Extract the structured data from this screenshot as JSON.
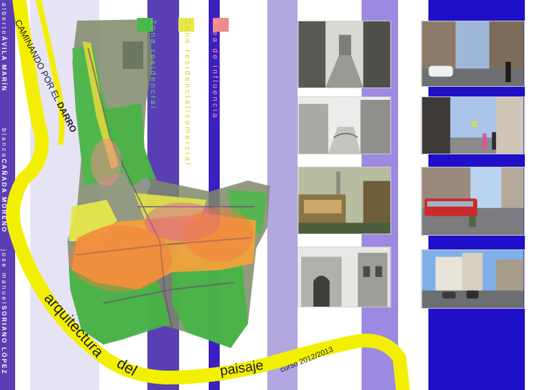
{
  "colors": {
    "background": "#ffffff",
    "stripe_lavender": "#e6e3f4",
    "stripe_indigo": "#5a3fb4",
    "stripe_deep": "#3b1fc0",
    "stripe_light_purple": "#b3a7e0",
    "stripe_medium_purple": "#9d8ae0",
    "stripe_royal": "#1f0fc8",
    "ribbon_yellow": "#f3ef00",
    "zone_residential": "#4cb84a",
    "zone_mixed": "#e7e84a",
    "zone_influence": "#ee8a8a",
    "influence_orange": "#f6a23c",
    "influence_magenta": "#d75aa7"
  },
  "legend": {
    "zona_residencial": "Zona residencial",
    "zona_residencial_comercial": "Zona residencial/comercial",
    "area_influencia": "Área de influencia"
  },
  "title": {
    "line1": "CAMINANDO POR EL",
    "highlight": "DARRO",
    "subtitle_1": "arquitectura",
    "subtitle_2": "del",
    "subtitle_3": "paisaje",
    "course": "curso 2012/2013"
  },
  "credits": {
    "author1_first": "alberto",
    "author1_last": "ÁVILA MARÍN",
    "author2_first": "blanca",
    "author2_last": "CAÑADA MORENO",
    "author3_first": "jose manuel",
    "author3_last": "SORIANO LÓPEZ"
  },
  "historic_images": [
    {
      "name": "engraving-river-canal",
      "icon": "engraving-icon"
    },
    {
      "name": "drawing-street-bridge",
      "icon": "drawing-icon"
    },
    {
      "name": "painting-riverside-houses",
      "icon": "painting-icon"
    },
    {
      "name": "engraving-gate-street",
      "icon": "engraving-icon"
    }
  ],
  "modern_images": [
    {
      "name": "photo-street-cars",
      "icon": "photo-icon"
    },
    {
      "name": "photo-pedestrians",
      "icon": "photo-icon"
    },
    {
      "name": "photo-red-bus",
      "icon": "photo-icon"
    },
    {
      "name": "photo-plaza",
      "icon": "photo-icon"
    }
  ]
}
